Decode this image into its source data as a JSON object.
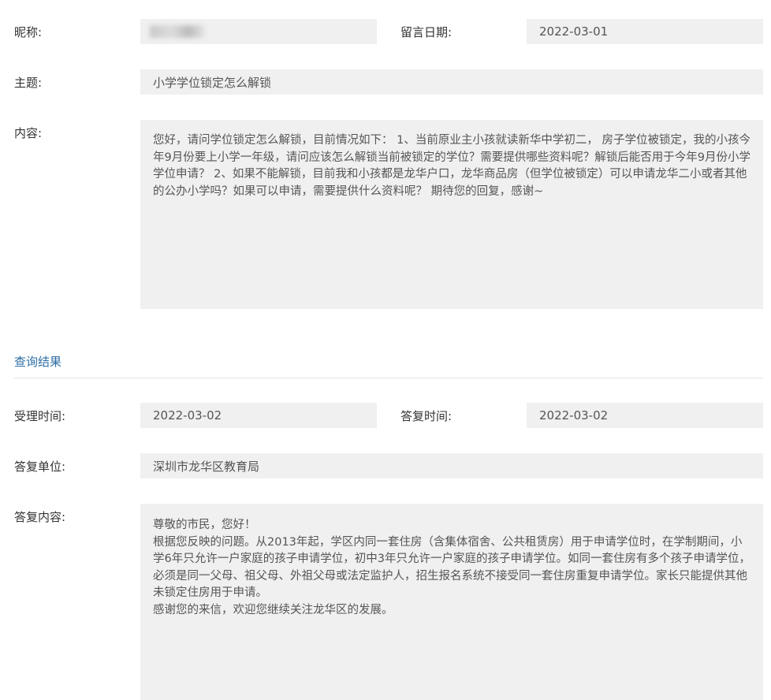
{
  "message": {
    "nickname_label": "昵称:",
    "nickname_value": "",
    "date_label": "留言日期:",
    "date_value": "2022-03-01",
    "subject_label": "主题:",
    "subject_value": "小学学位锁定怎么解锁",
    "content_label": "内容:",
    "content_value": "您好，请问学位锁定怎么解锁，目前情况如下： 1、当前原业主小孩就读新华中学初二， 房子学位被锁定，我的小孩今年9月份要上小学一年级，请问应该怎么解锁当前被锁定的学位？需要提供哪些资料呢？解锁后能否用于今年9月份小学学位申请？ 2、如果不能解锁，目前我和小孩都是龙华户口，龙华商品房（但学位被锁定）可以申请龙华二小或者其他的公办小学吗？如果可以申请，需要提供什么资料呢？ 期待您的回复，感谢~"
  },
  "result": {
    "section_title": "查询结果",
    "accept_time_label": "受理时间:",
    "accept_time_value": "2022-03-02",
    "reply_time_label": "答复时间:",
    "reply_time_value": "2022-03-02",
    "reply_unit_label": "答复单位:",
    "reply_unit_value": "深圳市龙华区教育局",
    "reply_content_label": "答复内容:",
    "reply_content_value": "尊敬的市民，您好！\n根据您反映的问题。从2013年起，学区内同一套住房（含集体宿舍、公共租赁房）用于申请学位时，在学制期间，小学6年只允许一户家庭的孩子申请学位，初中3年只允许一户家庭的孩子申请学位。如同一套住房有多个孩子申请学位，必须是同一父母、祖父母、外祖父母或法定监护人，招生报名系统不接受同一套住房重复申请学位。家长只能提供其他未锁定住房用于申请。\n感谢您的来信，欢迎您继续关注龙华区的发展。"
  }
}
